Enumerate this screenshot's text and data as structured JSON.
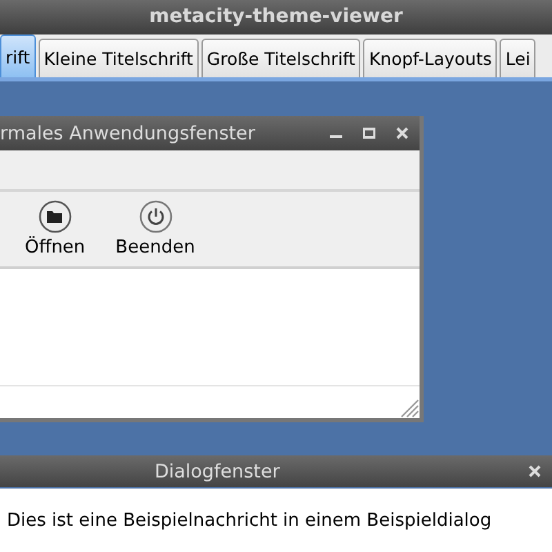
{
  "window": {
    "title": "metacity-theme-viewer"
  },
  "tabs": [
    {
      "label": "rift",
      "selected": true
    },
    {
      "label": "Kleine Titelschrift",
      "selected": false
    },
    {
      "label": "Große Titelschrift",
      "selected": false
    },
    {
      "label": "Knopf-Layouts",
      "selected": false
    },
    {
      "label": "Lei",
      "selected": false
    }
  ],
  "app_window": {
    "title": "rmales Anwendungsfenster",
    "toolbar": [
      {
        "kind": "open",
        "label": "Öffnen"
      },
      {
        "kind": "quit",
        "label": "Beenden"
      }
    ]
  },
  "dialog": {
    "title": "Dialogfenster",
    "message": "Dies ist eine Beispielnachricht in einem Beispieldialog"
  }
}
